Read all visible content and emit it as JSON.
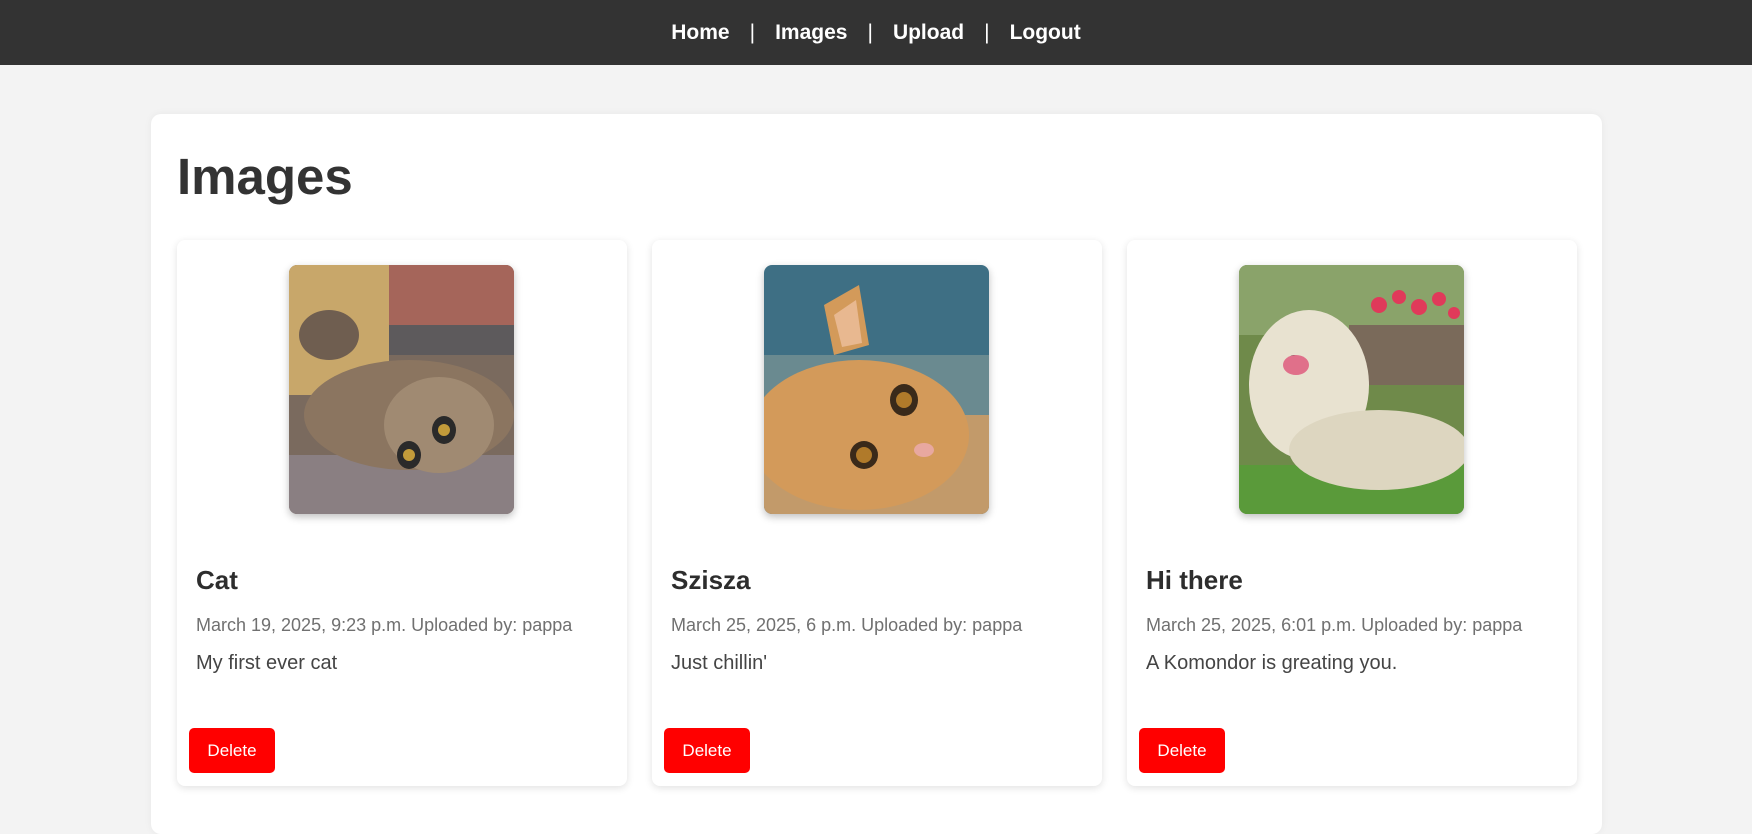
{
  "nav": {
    "items": [
      {
        "label": "Home"
      },
      {
        "label": "Images"
      },
      {
        "label": "Upload"
      },
      {
        "label": "Logout"
      }
    ],
    "separator": "|"
  },
  "page": {
    "title": "Images"
  },
  "cards": [
    {
      "title": "Cat",
      "meta": "March 19, 2025, 9:23 p.m. Uploaded by: pappa",
      "description": "My first ever cat",
      "delete_label": "Delete",
      "image": "tabby-cat-photo"
    },
    {
      "title": "Szisza",
      "meta": "March 25, 2025, 6 p.m. Uploaded by: pappa",
      "description": "Just chillin'",
      "delete_label": "Delete",
      "image": "orange-cat-photo"
    },
    {
      "title": "Hi there",
      "meta": "March 25, 2025, 6:01 p.m. Uploaded by: pappa",
      "description": "A Komondor is greating you.",
      "delete_label": "Delete",
      "image": "komondor-dog-photo"
    }
  ],
  "colors": {
    "navbar_bg": "#333333",
    "page_bg": "#f3f3f3",
    "delete_button": "#ff0000"
  }
}
